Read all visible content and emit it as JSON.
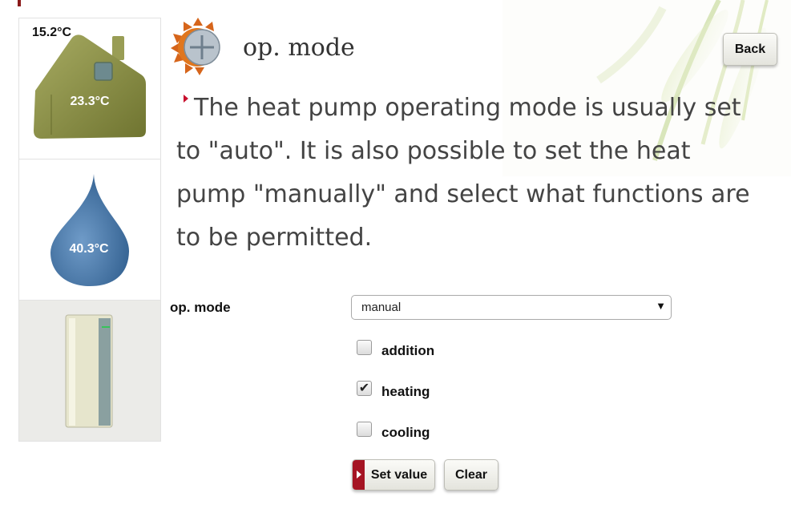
{
  "sidebar": {
    "outdoor_temp": "15.2°C",
    "indoor_temp": "23.3°C",
    "water_temp": "40.3°C"
  },
  "header": {
    "title": "op. mode",
    "back_label": "Back"
  },
  "description": "The heat pump operating mode is usually set to \"auto\". It is also possible to set the heat pump \"manually\" and select what functions are to be permitted.",
  "form": {
    "op_mode_label": "op. mode",
    "op_mode_value": "manual",
    "options": [
      {
        "label": "addition",
        "checked": false
      },
      {
        "label": "heating",
        "checked": true
      },
      {
        "label": "cooling",
        "checked": false
      }
    ],
    "set_value_label": "Set value",
    "clear_label": "Clear"
  },
  "colors": {
    "accent_red": "#a51423",
    "house_green": "#8f9447",
    "water_blue": "#4a78a8"
  }
}
